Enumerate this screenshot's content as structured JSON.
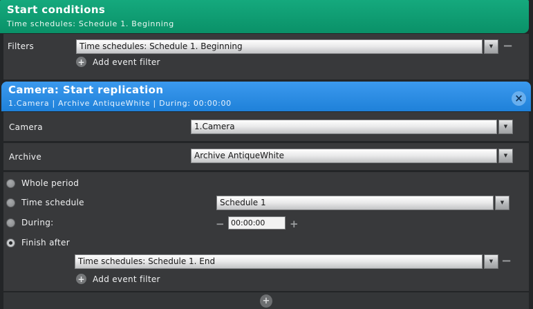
{
  "icons": {
    "plus": "+",
    "minus": "−",
    "dropdown_arrow": "▼",
    "close": "×"
  },
  "start_conditions": {
    "title": "Start conditions",
    "subtitle": "Time schedules: Schedule 1. Beginning",
    "filters_label": "Filters",
    "filter_value": "Time schedules: Schedule 1. Beginning",
    "add_event_filter_label": "Add event filter"
  },
  "camera_action": {
    "title": "Camera: Start replication",
    "subtitle": "1.Camera | Archive AntiqueWhite | During: 00:00:00",
    "camera_label": "Camera",
    "camera_value": "1.Camera",
    "archive_label": "Archive",
    "archive_value": "Archive AntiqueWhite",
    "options": {
      "whole_period": "Whole period",
      "time_schedule": "Time schedule",
      "during": "During:",
      "finish_after": "Finish after"
    },
    "selected_option": "Finish after",
    "time_schedule_value": "Schedule 1",
    "during_value": "00:00:00",
    "finish_filter_value": "Time schedules: Schedule 1. End",
    "add_event_filter_label": "Add event filter"
  },
  "colors": {
    "green_header": "#0da176",
    "blue_header": "#2a8ce4",
    "section_bg": "#38393b",
    "page_bg": "#232527"
  }
}
